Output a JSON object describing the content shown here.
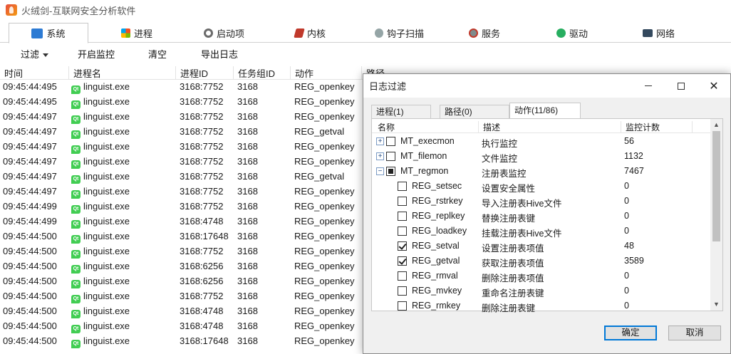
{
  "window": {
    "title": "火绒剑-互联网安全分析软件"
  },
  "tabs": [
    {
      "label": "系统",
      "icon": "system-icon",
      "color": "#2d7bd4"
    },
    {
      "label": "进程",
      "icon": "windows-icon",
      "color": "#e4572e"
    },
    {
      "label": "启动项",
      "icon": "startup-icon",
      "color": "#6b6b6b"
    },
    {
      "label": "内核",
      "icon": "kernel-icon",
      "color": "#c0392b"
    },
    {
      "label": "钩子扫描",
      "icon": "hook-icon",
      "color": "#7f8c8d"
    },
    {
      "label": "服务",
      "icon": "service-icon",
      "color": "#c0392b"
    },
    {
      "label": "驱动",
      "icon": "driver-icon",
      "color": "#27ae60"
    },
    {
      "label": "网络",
      "icon": "network-icon",
      "color": "#2c3e50"
    }
  ],
  "toolbar": {
    "filter": "过滤",
    "start_monitor": "开启监控",
    "clear": "清空",
    "export_log": "导出日志"
  },
  "columns": {
    "time": "时间",
    "process": "进程名",
    "pid": "进程ID",
    "job": "任务组ID",
    "action": "动作",
    "path": "路径"
  },
  "rows": [
    {
      "time": "09:45:44:495",
      "process": "linguist.exe",
      "pid": "3168:7752",
      "job": "3168",
      "action": "REG_openkey"
    },
    {
      "time": "09:45:44:495",
      "process": "linguist.exe",
      "pid": "3168:7752",
      "job": "3168",
      "action": "REG_openkey"
    },
    {
      "time": "09:45:44:497",
      "process": "linguist.exe",
      "pid": "3168:7752",
      "job": "3168",
      "action": "REG_openkey"
    },
    {
      "time": "09:45:44:497",
      "process": "linguist.exe",
      "pid": "3168:7752",
      "job": "3168",
      "action": "REG_getval"
    },
    {
      "time": "09:45:44:497",
      "process": "linguist.exe",
      "pid": "3168:7752",
      "job": "3168",
      "action": "REG_openkey"
    },
    {
      "time": "09:45:44:497",
      "process": "linguist.exe",
      "pid": "3168:7752",
      "job": "3168",
      "action": "REG_openkey"
    },
    {
      "time": "09:45:44:497",
      "process": "linguist.exe",
      "pid": "3168:7752",
      "job": "3168",
      "action": "REG_getval"
    },
    {
      "time": "09:45:44:497",
      "process": "linguist.exe",
      "pid": "3168:7752",
      "job": "3168",
      "action": "REG_openkey"
    },
    {
      "time": "09:45:44:499",
      "process": "linguist.exe",
      "pid": "3168:7752",
      "job": "3168",
      "action": "REG_openkey"
    },
    {
      "time": "09:45:44:499",
      "process": "linguist.exe",
      "pid": "3168:4748",
      "job": "3168",
      "action": "REG_openkey"
    },
    {
      "time": "09:45:44:500",
      "process": "linguist.exe",
      "pid": "3168:17648",
      "job": "3168",
      "action": "REG_openkey"
    },
    {
      "time": "09:45:44:500",
      "process": "linguist.exe",
      "pid": "3168:7752",
      "job": "3168",
      "action": "REG_openkey"
    },
    {
      "time": "09:45:44:500",
      "process": "linguist.exe",
      "pid": "3168:6256",
      "job": "3168",
      "action": "REG_openkey"
    },
    {
      "time": "09:45:44:500",
      "process": "linguist.exe",
      "pid": "3168:6256",
      "job": "3168",
      "action": "REG_openkey"
    },
    {
      "time": "09:45:44:500",
      "process": "linguist.exe",
      "pid": "3168:7752",
      "job": "3168",
      "action": "REG_openkey"
    },
    {
      "time": "09:45:44:500",
      "process": "linguist.exe",
      "pid": "3168:4748",
      "job": "3168",
      "action": "REG_openkey"
    },
    {
      "time": "09:45:44:500",
      "process": "linguist.exe",
      "pid": "3168:4748",
      "job": "3168",
      "action": "REG_openkey"
    },
    {
      "time": "09:45:44:500",
      "process": "linguist.exe",
      "pid": "3168:17648",
      "job": "3168",
      "action": "REG_openkey"
    }
  ],
  "dialog": {
    "title": "日志过滤",
    "tabs": [
      {
        "label": "进程(1)",
        "active": false
      },
      {
        "label": "路径(0)",
        "active": false
      },
      {
        "label": "动作(11/86)",
        "active": true
      }
    ],
    "columns": {
      "name": "名称",
      "desc": "描述",
      "count": "监控计数"
    },
    "items": [
      {
        "level": 0,
        "expander": "+",
        "state": "unchecked",
        "name": "MT_execmon",
        "desc": "执行监控",
        "count": "56"
      },
      {
        "level": 0,
        "expander": "+",
        "state": "unchecked",
        "name": "MT_filemon",
        "desc": "文件监控",
        "count": "1132"
      },
      {
        "level": 0,
        "expander": "−",
        "state": "partial",
        "name": "MT_regmon",
        "desc": "注册表监控",
        "count": "7467"
      },
      {
        "level": 1,
        "state": "unchecked",
        "name": "REG_setsec",
        "desc": "设置安全属性",
        "count": "0"
      },
      {
        "level": 1,
        "state": "unchecked",
        "name": "REG_rstrkey",
        "desc": "导入注册表Hive文件",
        "count": "0"
      },
      {
        "level": 1,
        "state": "unchecked",
        "name": "REG_replkey",
        "desc": "替换注册表键",
        "count": "0"
      },
      {
        "level": 1,
        "state": "unchecked",
        "name": "REG_loadkey",
        "desc": "挂载注册表Hive文件",
        "count": "0"
      },
      {
        "level": 1,
        "state": "checked",
        "name": "REG_setval",
        "desc": "设置注册表项值",
        "count": "48"
      },
      {
        "level": 1,
        "state": "checked",
        "name": "REG_getval",
        "desc": "获取注册表项值",
        "count": "3589"
      },
      {
        "level": 1,
        "state": "unchecked",
        "name": "REG_rmval",
        "desc": "删除注册表项值",
        "count": "0"
      },
      {
        "level": 1,
        "state": "unchecked",
        "name": "REG_mvkey",
        "desc": "重命名注册表键",
        "count": "0"
      },
      {
        "level": 1,
        "state": "unchecked",
        "name": "REG_rmkey",
        "desc": "删除注册表键",
        "count": "0"
      }
    ],
    "ok": "确定",
    "cancel": "取消"
  }
}
